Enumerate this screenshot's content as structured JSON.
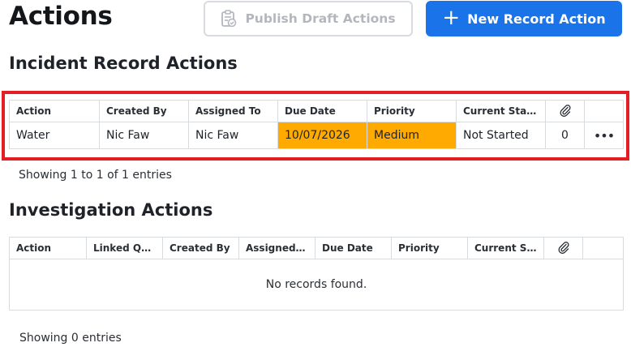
{
  "header": {
    "title": "Actions",
    "publish_label": "Publish Draft Actions",
    "new_label": "New Record Action"
  },
  "incident": {
    "title": "Incident Record Actions",
    "columns": [
      "Action",
      "Created By",
      "Assigned To",
      "Due Date",
      "Priority",
      "Current Status",
      ""
    ],
    "rows": [
      {
        "action": "Water",
        "created_by": "Nic Faw",
        "assigned_to": "Nic Faw",
        "due_date": "10/07/2026",
        "priority": "Medium",
        "status": "Not Started",
        "attachments": "0",
        "menu": "•••"
      }
    ],
    "footer": "Showing 1 to 1 of 1 entries"
  },
  "investigation": {
    "title": "Investigation Actions",
    "columns": [
      "Action",
      "Linked Que...",
      "Created By",
      "Assigned To",
      "Due Date",
      "Priority",
      "Current Sta..."
    ],
    "empty_message": "No records found.",
    "footer": "Showing 0 entries"
  },
  "colors": {
    "primary": "#1a73e8",
    "highlight": "#e31e24",
    "due_priority_bg": "#ffaa00"
  },
  "icons": {
    "publish": "clipboard-check-icon",
    "new": "plus-icon",
    "attachment": "paperclip-icon",
    "menu": "more-horizontal-icon"
  }
}
